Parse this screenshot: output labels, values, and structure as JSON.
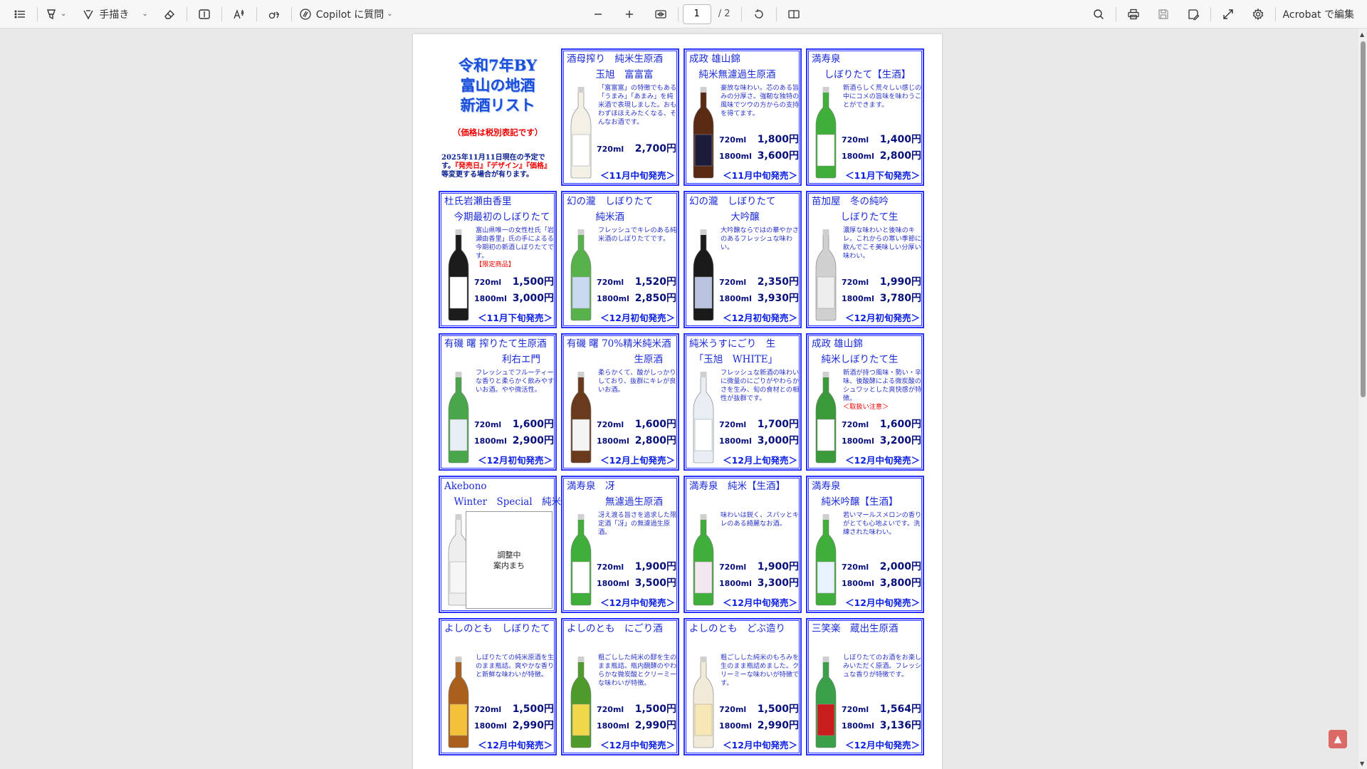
{
  "toolbar": {
    "draw_label": "手描き",
    "copilot_label": "Copilot に質問",
    "page_current": "1",
    "page_total": "/ 2",
    "edit_label": "Acrobat で編集"
  },
  "header": {
    "title": "令和7年BY\n富山の地酒\n新酒リスト",
    "tax": "（価格は税別表記です）",
    "note_a": "2025年11月11日現在の予定で す。",
    "note_red": "『発売日』『デザイン』『価格』",
    "note_b": "等変更する場合が有ります。"
  },
  "products": [
    {
      "name": "酒母搾り　純米生原酒\n　　　玉旭　富富富",
      "desc": "「富富富」の特徴でもある「うまみ」「あまみ」を純米酒で表現しました。おもわずほほえみたくなる、そんなお酒です。",
      "desc_red": "",
      "p720": "2,700円",
      "p1800": "",
      "release": "＜11月中旬発売＞",
      "bottle": "#f3f1e6",
      "label": "#ffffff"
    },
    {
      "name": "成政 雄山錦\n　純米無濾過生原酒",
      "desc": "豪放な味わい。芯のある旨みの分厚さ。強靭な独特の風味でツウの方からの支持を得てます。",
      "desc_red": "",
      "p720": "1,800円",
      "p1800": "3,600円",
      "release": "＜11月中旬発売＞",
      "bottle": "#5a2a12",
      "label": "#1b1b3a"
    },
    {
      "name": "満寿泉\n　 しぼりたて【生酒】",
      "desc": "新酒らしく荒々しい感じの中にコメの旨味を味わうことができます。",
      "desc_red": "",
      "p720": "1,400円",
      "p1800": "2,800円",
      "release": "＜11月下旬発売＞",
      "bottle": "#3fae3a",
      "label": "#ffffff"
    },
    {
      "name": "杜氏岩瀬由香里\n　今期最初のしぼりたて",
      "desc": "富山県唯一の女性杜氏「岩瀬由香里」氏の手によるる今期初の新酒しぼりたてです。",
      "desc_red": "【限定商品】",
      "p720": "1,500円",
      "p1800": "3,000円",
      "release": "＜11月下旬発売＞",
      "bottle": "#1c1c1c",
      "label": "#ffffff"
    },
    {
      "name": "幻の瀧　しぼりたて\n　　　純米酒",
      "desc": "フレッシュでキレのある純米酒のしぼりたてです。",
      "desc_red": "",
      "p720": "1,520円",
      "p1800": "2,850円",
      "release": "＜12月初旬発売＞",
      "bottle": "#58b24c",
      "label": "#c9d9ef"
    },
    {
      "name": "幻の瀧　しぼりたて\n　　　　 大吟醸",
      "desc": "大吟醸ならではの華やかさのあるフレッシュな味わい。",
      "desc_red": "",
      "p720": "2,350円",
      "p1800": "3,930円",
      "release": "＜12月初旬発売＞",
      "bottle": "#1a1a1a",
      "label": "#b9c4e0"
    },
    {
      "name": "苗加屋　冬の純吟\n　　　しぼりたて生",
      "desc": "濃厚な味わいと後味のキレ。これからの寒い季節に飲んでこそ美味しい分厚い味わい。",
      "desc_red": "",
      "p720": "1,990円",
      "p1800": "3,780円",
      "release": "＜12月初旬発売＞",
      "bottle": "#d0d0d0",
      "label": "#eeeeee"
    },
    {
      "name": "有磯 曙 搾りたて生原酒\n　　　　　　利右エ門",
      "desc": "フレッシュでフルーティーな香りと柔らかく飲みやすいお酒。やや微活性。",
      "desc_red": "",
      "p720": "1,600円",
      "p1800": "2,900円",
      "release": "＜12月初旬発売＞",
      "bottle": "#4aa64a",
      "label": "#e7eef6"
    },
    {
      "name": "有磯 曙 70%精米純米酒\n　　　　　　　生原酒",
      "desc": "柔らかくて、酸がしっかりしており、抜群にキレが良いお酒。",
      "desc_red": "",
      "p720": "1,600円",
      "p1800": "2,800円",
      "release": "＜12月上旬発売＞",
      "bottle": "#6a3a1c",
      "label": "#f4f4f4"
    },
    {
      "name": "純米うすにごり　生\n　「玉旭　WHITE」",
      "desc": "フレッシュな新酒の味わいに微量のにごりがやわらかさを生み、旬の食材との相性が抜群です。",
      "desc_red": "",
      "p720": "1,700円",
      "p1800": "3,000円",
      "release": "＜12月上旬発売＞",
      "bottle": "#e8eef4",
      "label": "#ffffff"
    },
    {
      "name": "成政 雄山錦\n　純米しぼりたて生",
      "desc": "新酒が持つ風味・勢い・辛味、後酸酵による微炭酸のシュワッとした爽快感が特徴。",
      "desc_red": "＜取扱い注意＞",
      "p720": "1,600円",
      "p1800": "3,200円",
      "release": "＜12月中旬発売＞",
      "bottle": "#3a9a3a",
      "label": "#ffffff"
    },
    {
      "name": "Akebono\n　Winter　Special　純米",
      "desc": "",
      "desc_red": "",
      "p720": "",
      "p1800": "",
      "release": "",
      "bottle": "#eeeeee",
      "label": "#f6f6f6",
      "pending": "調整中\n案内まち"
    },
    {
      "name": "満寿泉　冴\n　　　　無濾過生原酒",
      "desc": "冴え渡る旨さを追求した限定酒「冴」の無濾過生原酒。",
      "desc_red": "",
      "p720": "1,900円",
      "p1800": "3,500円",
      "release": "＜12月中旬発売＞",
      "bottle": "#3fae3a",
      "label": "#ffffff"
    },
    {
      "name": "満寿泉　純米【生酒】",
      "desc": "味わいは鋭く、スパッとキレのある綺麗なお酒。",
      "desc_red": "",
      "p720": "1,900円",
      "p1800": "3,300円",
      "release": "＜12月中旬発売＞",
      "bottle": "#3fae3a",
      "label": "#f2e6f0"
    },
    {
      "name": "満寿泉\n　純米吟醸【生酒】",
      "desc": "若いマールスメロンの香りがとても心地よいです。洗練された味わい。",
      "desc_red": "",
      "p720": "2,000円",
      "p1800": "3,800円",
      "release": "＜12月中旬発売＞",
      "bottle": "#3fae3a",
      "label": "#e8f2ff"
    },
    {
      "name": "よしのとも　しぼりたて",
      "desc": "しぼりたての純米原酒を生のまま瓶詰。爽やかな香りと新鮮な味わいが特徴。",
      "desc_red": "",
      "p720": "1,500円",
      "p1800": "2,990円",
      "release": "＜12月中旬発売＞",
      "bottle": "#a8601c",
      "label": "#f4c23a"
    },
    {
      "name": "よしのとも　にごり酒",
      "desc": "粗ごしした純米の醪を生のまま瓶詰。瓶内醗酵のやわらかな微炭酸とクリーミーな味わいが特徴。",
      "desc_red": "",
      "p720": "1,500円",
      "p1800": "2,990円",
      "release": "＜12月中旬発売＞",
      "bottle": "#4e9a2a",
      "label": "#f0d84a"
    },
    {
      "name": "よしのとも　どぶ造り",
      "desc": "粗ごしした純米のもろみを生のまま瓶詰めました。クリーミーな味わいが特徴です。",
      "desc_red": "",
      "p720": "1,500円",
      "p1800": "2,990円",
      "release": "＜12月中旬発売＞",
      "bottle": "#f1ead8",
      "label": "#f6e7b4"
    },
    {
      "name": "三笑楽　蔵出生原酒",
      "desc": "しぼりたてのお酒をお楽しみいただく原酒。フレッシュな香りが特徴です。",
      "desc_red": "",
      "p720": "1,564円",
      "p1800": "3,136円",
      "release": "＜12月中旬発売＞",
      "bottle": "#3aa04a",
      "label": "#c81e1e"
    }
  ],
  "vol_720": "720ml",
  "vol_1800": "1800ml"
}
